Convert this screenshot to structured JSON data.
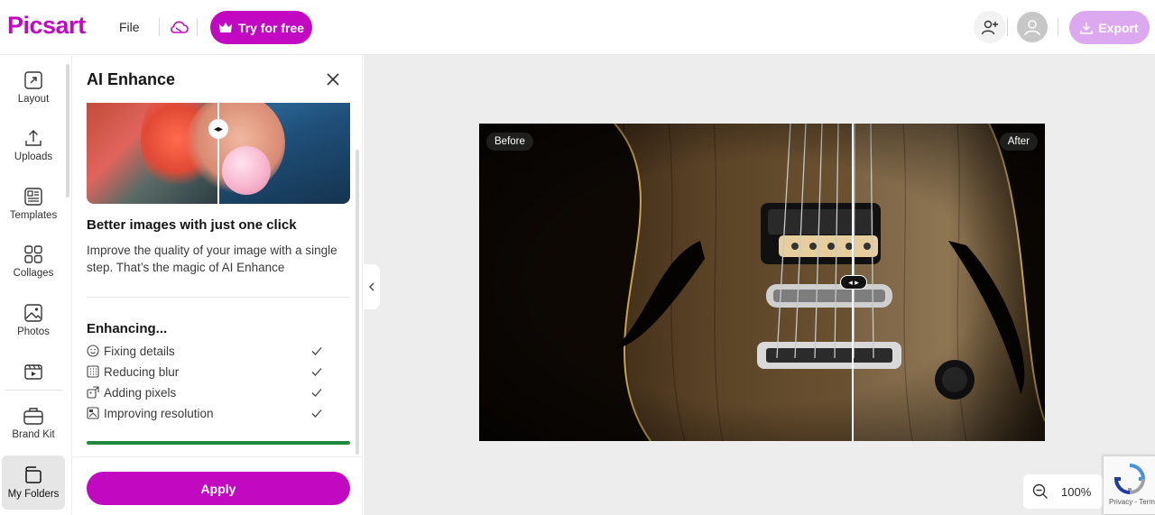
{
  "topbar": {
    "logo": "Picsart",
    "file_label": "File",
    "try_label": "Try for free",
    "export_label": "Export",
    "brand_color": "#c209c1",
    "icons": [
      "cloud-icon",
      "crown-icon",
      "add-user-icon",
      "avatar-icon",
      "download-icon"
    ]
  },
  "rail": {
    "items": [
      {
        "label": "Layout",
        "icon": "layout-icon"
      },
      {
        "label": "Uploads",
        "icon": "upload-icon"
      },
      {
        "label": "Templates",
        "icon": "templates-icon"
      },
      {
        "label": "Collages",
        "icon": "collages-icon"
      },
      {
        "label": "Photos",
        "icon": "photos-icon"
      },
      {
        "label": "",
        "icon": "video-icon"
      },
      {
        "label": "Brand Kit",
        "icon": "brand-kit-icon"
      },
      {
        "label": "My Folders",
        "icon": "folder-icon",
        "active": true
      }
    ]
  },
  "panel": {
    "title": "AI Enhance",
    "subtitle": "Better images with just one click",
    "description": "Improve the quality of your image with a single step. That’s the magic of AI Enhance",
    "enhancing_title": "Enhancing...",
    "steps": [
      {
        "label": "Fixing details",
        "icon": "smile-icon",
        "done": true
      },
      {
        "label": "Reducing blur",
        "icon": "blur-icon",
        "done": true
      },
      {
        "label": "Adding pixels",
        "icon": "pixels-icon",
        "done": true
      },
      {
        "label": "Improving resolution",
        "icon": "resolution-icon",
        "done": true
      }
    ],
    "progress": 1.0,
    "progress_color": "#1e8a3c",
    "apply_label": "Apply"
  },
  "canvas": {
    "before_label": "Before",
    "after_label": "After",
    "zoom": "100%"
  },
  "recaptcha": {
    "text": "Privacy - Terms"
  }
}
